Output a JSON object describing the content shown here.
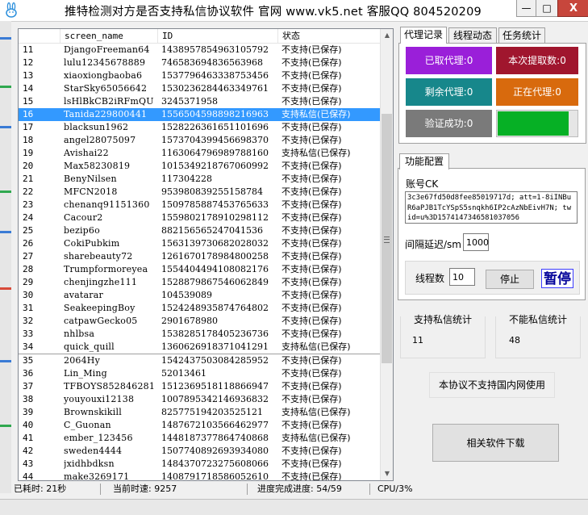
{
  "window": {
    "title": "推特检测对方是否支持私信协议软件 官网 www.vk5.net 客服QQ 804520209",
    "min_glyph": "—",
    "max_glyph": "□",
    "close_glyph": "X"
  },
  "table": {
    "columns": [
      "",
      "screen_name",
      "ID",
      "状态"
    ],
    "rows": [
      {
        "no": "11",
        "name": "DjangoFreeman64",
        "id": "1438957854963105792",
        "status": "不支持(已保存)"
      },
      {
        "no": "12",
        "name": "lulu12345678889",
        "id": "746583694836563968",
        "status": "不支持(已保存)"
      },
      {
        "no": "13",
        "name": "xiaoxiongbaoba6",
        "id": "1537796463338753456",
        "status": "不支持(已保存)"
      },
      {
        "no": "14",
        "name": "StarSky65056642",
        "id": "1530236284463349761",
        "status": "不支持(已保存)"
      },
      {
        "no": "15",
        "name": "lsHlBkCB2iRFmQU",
        "id": "3245371958",
        "status": "不支持(已保存)"
      },
      {
        "no": "16",
        "name": "Tanida229800441",
        "id": "1556504598898216963",
        "status": "支持私信(已保存)",
        "selected": true
      },
      {
        "no": "17",
        "name": "blacksun1962",
        "id": "1528226361651101696",
        "status": "不支持(已保存)"
      },
      {
        "no": "18",
        "name": "angel28075097",
        "id": "1573704399456698370",
        "status": "不支持(已保存)"
      },
      {
        "no": "19",
        "name": "Avishai22",
        "id": "1163064796989788160",
        "status": "支持私信(已保存)"
      },
      {
        "no": "20",
        "name": "Max58230819",
        "id": "1015349218767060992",
        "status": "不支持(已保存)"
      },
      {
        "no": "21",
        "name": "BenyNilsen",
        "id": "117304228",
        "status": "不支持(已保存)"
      },
      {
        "no": "22",
        "name": "MFCN2018",
        "id": "953980839255158784",
        "status": "不支持(已保存)"
      },
      {
        "no": "23",
        "name": "chenanq91151360",
        "id": "1509785887453765633",
        "status": "不支持(已保存)"
      },
      {
        "no": "24",
        "name": "Cacour2",
        "id": "1559802178910298112",
        "status": "不支持(已保存)"
      },
      {
        "no": "25",
        "name": "bezip6o",
        "id": "882156565247041536",
        "status": "不支持(已保存)"
      },
      {
        "no": "26",
        "name": "CokiPubkim",
        "id": "1563139730682028032",
        "status": "不支持(已保存)"
      },
      {
        "no": "27",
        "name": "sharebeauty72",
        "id": "1261670178984800258",
        "status": "不支持(已保存)"
      },
      {
        "no": "28",
        "name": "Trumpformoreyea",
        "id": "1554404494108082176",
        "status": "不支持(已保存)"
      },
      {
        "no": "29",
        "name": "chenjingzhe111",
        "id": "1528879867546062849",
        "status": "不支持(已保存)"
      },
      {
        "no": "30",
        "name": "avatarar",
        "id": "104539089",
        "status": "不支持(已保存)"
      },
      {
        "no": "31",
        "name": "SeakeepingBoy",
        "id": "1524248935874764802",
        "status": "不支持(已保存)"
      },
      {
        "no": "32",
        "name": "catpawGecko05",
        "id": "2901678980",
        "status": "不支持(已保存)"
      },
      {
        "no": "33",
        "name": "nhlbsa",
        "id": "1538285178405236736",
        "status": "不支持(已保存)"
      },
      {
        "no": "34",
        "name": "quick_quill",
        "id": "1360626918371041291",
        "status": "支持私信(已保存)"
      },
      {
        "no": "35",
        "name": "2064Hy",
        "id": "1542437503084285952",
        "status": "不支持(已保存)",
        "separator": true
      },
      {
        "no": "36",
        "name": "Lin_Ming",
        "id": "52013461",
        "status": "不支持(已保存)"
      },
      {
        "no": "37",
        "name": "TFBOYS852846281",
        "id": "1512369518118866947",
        "status": "不支持(已保存)"
      },
      {
        "no": "38",
        "name": "youyouxi12138",
        "id": "1007895342146936832",
        "status": "不支持(已保存)"
      },
      {
        "no": "39",
        "name": "Brownskikill",
        "id": "825775194203525121",
        "status": "支持私信(已保存)"
      },
      {
        "no": "40",
        "name": "C_Guonan",
        "id": "1487672103566462977",
        "status": "不支持(已保存)"
      },
      {
        "no": "41",
        "name": "ember_123456",
        "id": "1448187377864740868",
        "status": "支持私信(已保存)"
      },
      {
        "no": "42",
        "name": "sweden4444",
        "id": "1507740892693934080",
        "status": "不支持(已保存)"
      },
      {
        "no": "43",
        "name": "jxidhbdksn",
        "id": "1484370723275608066",
        "status": "不支持(已保存)"
      },
      {
        "no": "44",
        "name": "make3269171",
        "id": "1408791718586052610",
        "status": "不支持(已保存)"
      }
    ]
  },
  "tabs": [
    "代理记录",
    "线程动态",
    "任务统计"
  ],
  "proxy_tiles": {
    "taken": "已取代理:0",
    "this_take": "本次提取数:0",
    "remaining": "剩余代理:0",
    "in_use": "正在代理:0",
    "verified": "验证成功:0"
  },
  "progress_fraction": 0.9,
  "colors": {
    "purple": "#9a1fd9",
    "darkred": "#a0162e",
    "teal": "#17878b",
    "orange": "#d86a0d",
    "gray": "#7a7a7a",
    "progress_green": "#06b025",
    "selection": "#3399ff",
    "close_red": "#c7463c"
  },
  "func": {
    "tab": "功能配置",
    "account_label": "账号CK",
    "cookie": "3c3e67fd50d8fee85019717d; att=1-8iINBuR6aPJB1TcYSpS5snqkh6IP2cAzNbEivH7N; twid=u%3D1574147346581037056",
    "interval_label": "间隔延迟/sm",
    "interval_value": "1000",
    "thread_label": "线程数",
    "thread_value": "10",
    "stop_label": "停止",
    "pause_label": "暂停"
  },
  "stats": {
    "support_title": "支持私信统计",
    "support_value": "11",
    "nosupport_title": "不能私信统计",
    "nosupport_value": "48"
  },
  "note": "本协议不支持国内网使用",
  "download_label": "相关软件下载",
  "status_bar": {
    "elapsed": "已耗时: 21秒",
    "speed": "当前时速: 9257",
    "progress": "进度完成进度: 54/59",
    "cpu": "CPU/3%"
  }
}
